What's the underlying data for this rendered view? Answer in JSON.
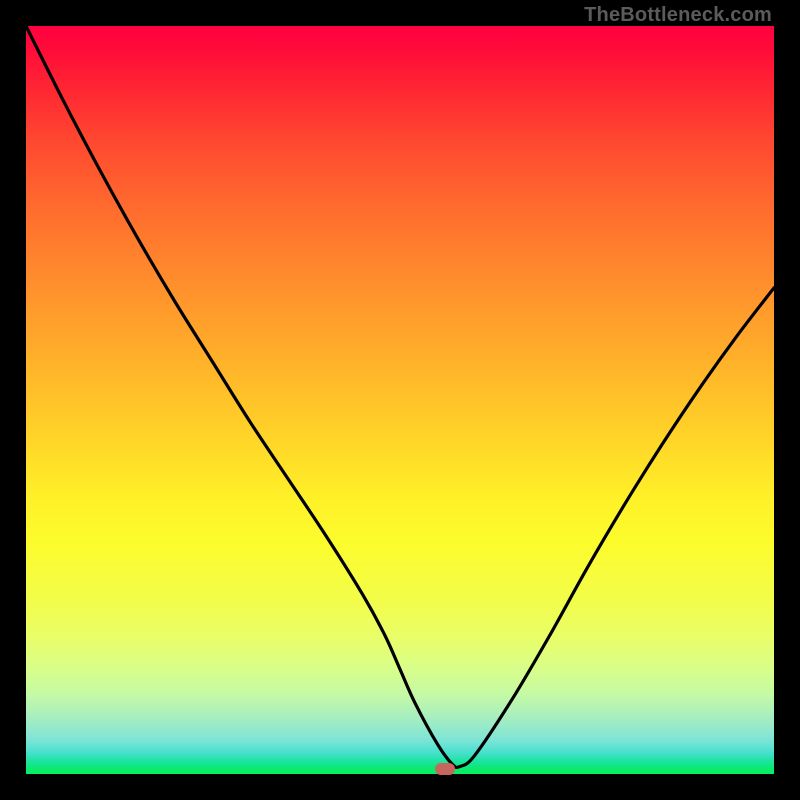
{
  "watermark": "TheBottleneck.com",
  "chart_data": {
    "type": "line",
    "title": "",
    "xlabel": "",
    "ylabel": "",
    "xlim": [
      0,
      100
    ],
    "ylim": [
      0,
      100
    ],
    "grid": false,
    "background": "rainbow-vertical",
    "series": [
      {
        "name": "curve",
        "x": [
          0,
          5,
          10,
          15,
          20,
          25,
          30,
          35,
          40,
          45,
          48,
          50,
          52,
          55,
          57,
          58,
          60,
          65,
          70,
          75,
          80,
          85,
          90,
          95,
          100
        ],
        "y": [
          100,
          90,
          80.5,
          71.5,
          63,
          55,
          47,
          39.5,
          32,
          24,
          18.5,
          14,
          9.5,
          4,
          1.3,
          1.0,
          2.5,
          10,
          18.5,
          27.5,
          36,
          44,
          51.5,
          58.5,
          65
        ]
      }
    ],
    "marker": {
      "x": 56,
      "y": 0.7,
      "color": "#c7665e"
    },
    "colors": {
      "top": "#ff0040",
      "mid": "#ffd428",
      "bottom": "#05ef5c",
      "curve": "#000000",
      "frame": "#000000"
    }
  }
}
